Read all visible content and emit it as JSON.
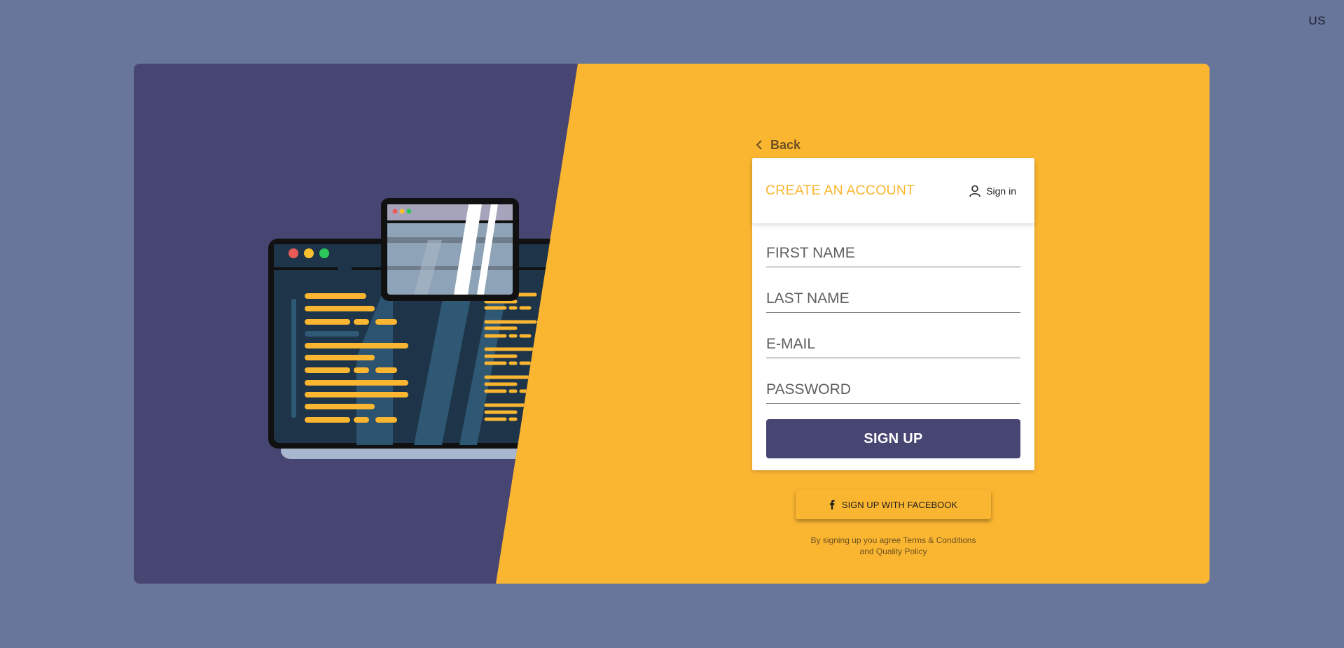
{
  "header": {
    "language": "US"
  },
  "colors": {
    "background": "#68769b",
    "purple": "#474572",
    "yellow": "#fbb631"
  },
  "illustration": {
    "name": "code-editor-illustration"
  },
  "nav": {
    "back_label": "Back",
    "back_icon": "chevron-left-icon"
  },
  "form": {
    "title": "CREATE AN ACCOUNT",
    "signin_label": "Sign in",
    "signin_icon": "user-icon",
    "fields": {
      "first_name": {
        "placeholder": "FIRST NAME",
        "value": ""
      },
      "last_name": {
        "placeholder": "LAST NAME",
        "value": ""
      },
      "email": {
        "placeholder": "E-MAIL",
        "value": ""
      },
      "password": {
        "placeholder": "PASSWORD",
        "value": ""
      }
    },
    "submit_label": "SIGN UP"
  },
  "social": {
    "facebook_label": "SIGN UP WITH FACEBOOK",
    "facebook_icon": "facebook-icon"
  },
  "terms": {
    "line1": "By signing up you agree Terms & Conditions",
    "line2": "and Quality Policy"
  }
}
